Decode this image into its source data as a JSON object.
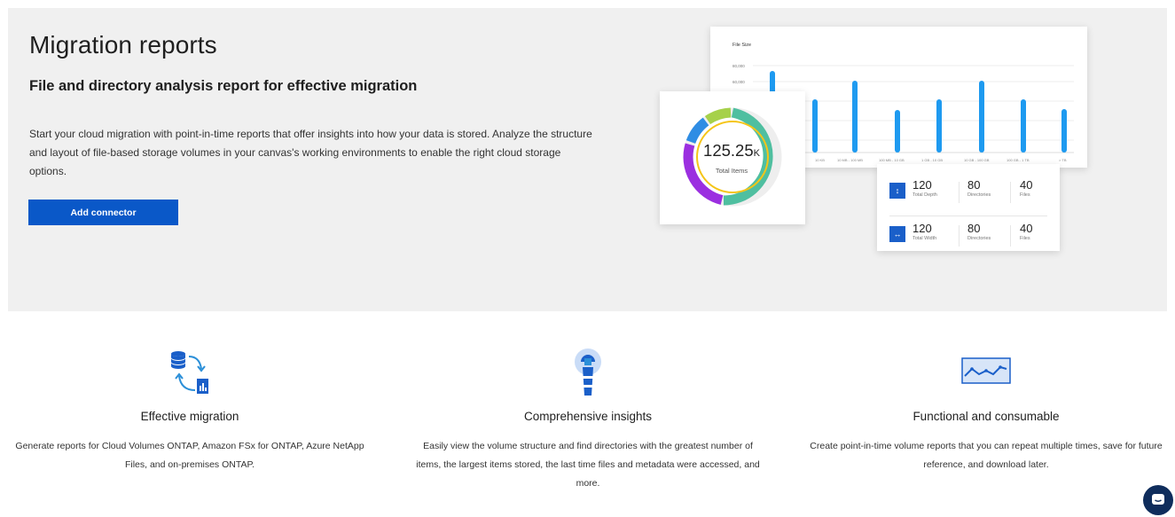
{
  "hero": {
    "title": "Migration reports",
    "subtitle": "File and directory analysis report for effective migration",
    "description": "Start your cloud migration with point-in-time reports that offer insights into how your data is stored. Analyze the structure and layout of file-based storage volumes in your canvas's working environments to enable the right cloud storage options.",
    "button_label": "Add connector",
    "accent_color": "#0a58c8"
  },
  "illustration": {
    "bar_card": {
      "title": "File Size",
      "y_ticks": [
        "80,000",
        "60,000"
      ],
      "x_labels": [
        "10 KB",
        "10 MB - 100 MB",
        "100 MB - 10 GB",
        "1 GB - 10 GB",
        "10 GB - 100 GB",
        "100 GB - 1 TB",
        "> TB"
      ]
    },
    "donut_card": {
      "value": "125.25",
      "unit": "K",
      "label": "Total Items"
    },
    "stats_card": {
      "rows": [
        {
          "icon": "vertical-arrows-icon",
          "glyph": "↕",
          "stats": [
            {
              "value": "120",
              "label": "Total Depth"
            },
            {
              "value": "80",
              "label": "Directories"
            },
            {
              "value": "40",
              "label": "Files"
            }
          ]
        },
        {
          "icon": "horizontal-arrows-icon",
          "glyph": "↔",
          "stats": [
            {
              "value": "120",
              "label": "Total Width"
            },
            {
              "value": "80",
              "label": "Directories"
            },
            {
              "value": "40",
              "label": "Files"
            }
          ]
        }
      ]
    }
  },
  "features": [
    {
      "icon": "database-sync-icon",
      "title": "Effective migration",
      "description": "Generate reports for Cloud Volumes ONTAP, Amazon FSx for ONTAP, Azure NetApp Files, and on-premises ONTAP."
    },
    {
      "icon": "lighthouse-icon",
      "title": "Comprehensive insights",
      "description": "Easily view the volume structure and find directories with the greatest number of items, the largest items stored, the last time files and metadata were accessed, and more."
    },
    {
      "icon": "line-chart-icon",
      "title": "Functional and consumable",
      "description": "Create point-in-time volume reports that you can repeat multiple times, save for future reference, and download later."
    }
  ],
  "chat": {
    "icon": "chat-icon"
  }
}
